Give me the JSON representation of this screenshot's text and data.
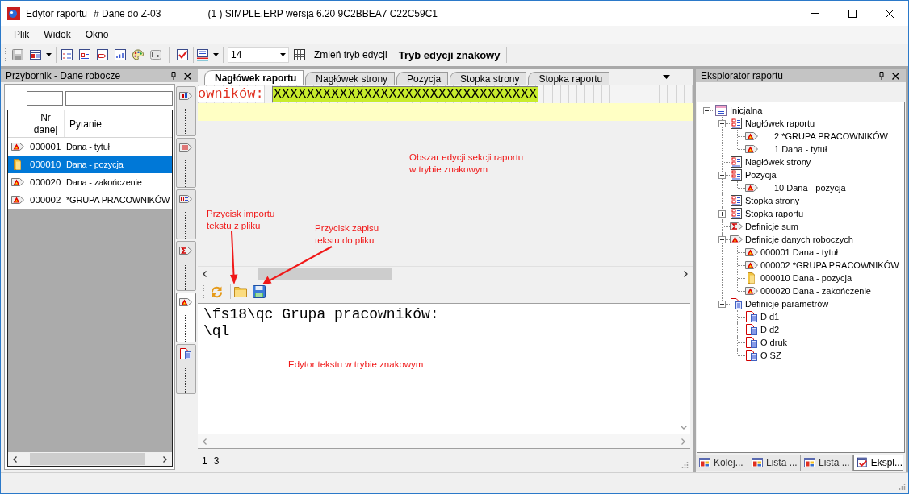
{
  "window": {
    "title": "Edytor raportu",
    "document": "# Dane do Z-03",
    "version_info": "(1 ) SIMPLE.ERP wersja 6.20 9C2BBEA7 C22C59C1"
  },
  "menu": [
    {
      "label": "Plik"
    },
    {
      "label": "Widok"
    },
    {
      "label": "Okno"
    }
  ],
  "toolbar": {
    "font_size": "14",
    "mode_button": "Zmień tryb edycji",
    "mode_label": "Tryb edycji znakowy"
  },
  "toolbox_panel": {
    "title": "Przybornik - Dane robocze",
    "columns": [
      "Nr danej",
      "Pytanie"
    ],
    "rows": [
      {
        "kind": "field",
        "number": "000001",
        "question": "Dana - tytuł",
        "selected": false
      },
      {
        "kind": "folder",
        "number": "000010",
        "question": "Dana - pozycja",
        "selected": true
      },
      {
        "kind": "field",
        "number": "000020",
        "question": "Dana - zakończenie",
        "selected": false
      },
      {
        "kind": "field",
        "number": "000002",
        "question": "*GRUPA PRACOWNIKÓW",
        "selected": false
      }
    ]
  },
  "toolbox_buttons": [
    {
      "kind": "data",
      "selected": false
    },
    {
      "kind": "list",
      "selected": false
    },
    {
      "kind": "index",
      "selected": false
    },
    {
      "kind": "sum",
      "selected": false
    },
    {
      "kind": "field",
      "selected": true
    },
    {
      "kind": "parameter",
      "selected": false
    }
  ],
  "tabs": [
    {
      "label": "Nagłówek raportu",
      "selected": true
    },
    {
      "label": "Nagłówek strony",
      "selected": false
    },
    {
      "label": "Pozycja",
      "selected": false
    },
    {
      "label": "Stopka strony",
      "selected": false
    },
    {
      "label": "Stopka raportu",
      "selected": false
    }
  ],
  "section_editor": {
    "text": "owników:",
    "field_text": "XXXXXXXXXXXXXXXXXXXXXXXXXXXXXXXX",
    "note": "Obszar edycji sekcji raportu\nw trybie znakowym"
  },
  "editor_toolbar": {
    "import_note": "Przycisk importu\ntekstu z pliku",
    "save_note": "Przycisk zapisu\ntekstu do pliku"
  },
  "text_editor": {
    "lines": [
      "\\fs18\\qc Grupa pracowników:",
      "\\ql"
    ],
    "note": "Edytor tekstu w trybie znakowym"
  },
  "editor_status": {
    "line": "1",
    "column": "3"
  },
  "explorer_panel": {
    "title": "Eksplorator raportu",
    "tree": [
      {
        "label": "Inicjalna",
        "kind": "report",
        "expanded": true,
        "children": [
          {
            "label": "Nagłówek raportu",
            "kind": "section",
            "expanded": true,
            "children": [
              {
                "label": "2 *GRUPA PRACOWNIKÓW",
                "kind": "placed"
              },
              {
                "label": "1 Dana - tytuł",
                "kind": "placed"
              }
            ]
          },
          {
            "label": "Nagłówek strony",
            "kind": "section"
          },
          {
            "label": "Pozycja",
            "kind": "section",
            "expanded": true,
            "children": [
              {
                "label": "10 Dana - pozycja",
                "kind": "placed"
              }
            ]
          },
          {
            "label": "Stopka strony",
            "kind": "section"
          },
          {
            "label": "Stopka raportu",
            "kind": "section",
            "expanded": false
          },
          {
            "label": "Definicje sum",
            "kind": "sum"
          },
          {
            "label": "Definicje danych roboczych",
            "kind": "field",
            "expanded": true,
            "children": [
              {
                "label": "000001 Dana - tytuł",
                "kind": "field"
              },
              {
                "label": "000002 *GRUPA PRACOWNIKÓW",
                "kind": "field"
              },
              {
                "label": "000010 Dana - pozycja",
                "kind": "folder"
              },
              {
                "label": "000020 Dana - zakończenie",
                "kind": "field"
              }
            ]
          },
          {
            "label": "Definicje parametrów",
            "kind": "parameter",
            "expanded": true,
            "children": [
              {
                "label": "D d1",
                "kind": "parameter"
              },
              {
                "label": "D d2",
                "kind": "parameter"
              },
              {
                "label": "O druk",
                "kind": "parameter"
              },
              {
                "label": "O SZ",
                "kind": "parameter"
              }
            ]
          }
        ]
      }
    ]
  },
  "explorer_tabs": [
    {
      "label": "Kolej...",
      "kind": "list",
      "selected": false
    },
    {
      "label": "Lista ...",
      "kind": "list",
      "selected": false
    },
    {
      "label": "Lista ...",
      "kind": "list",
      "selected": false
    },
    {
      "label": "Ekspl...",
      "kind": "explorer",
      "selected": true
    }
  ]
}
